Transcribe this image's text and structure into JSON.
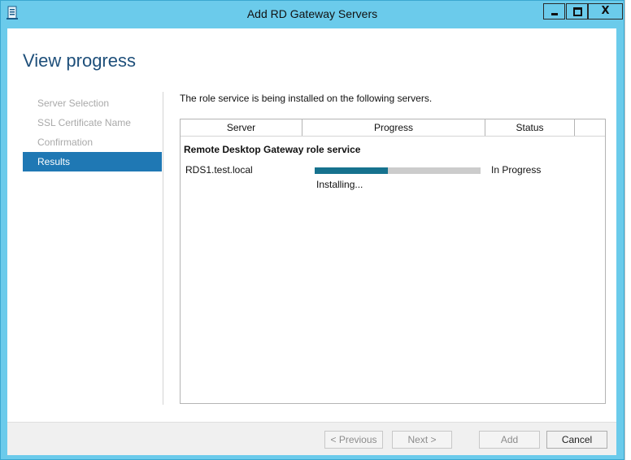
{
  "window": {
    "title": "Add RD Gateway Servers",
    "close_label": "X",
    "icons": [
      "server-manager-icon",
      "minimize-icon",
      "maximize-icon",
      "close-icon"
    ]
  },
  "page_title": "View progress",
  "nav": {
    "items": [
      {
        "label": "Server Selection",
        "state": "disabled"
      },
      {
        "label": "SSL Certificate Name",
        "state": "disabled"
      },
      {
        "label": "Confirmation",
        "state": "disabled"
      },
      {
        "label": "Results",
        "state": "active"
      }
    ]
  },
  "main": {
    "description": "The role service is being installed on the following servers.",
    "table": {
      "columns": [
        "Server",
        "Progress",
        "Status",
        ""
      ],
      "group": "Remote Desktop Gateway role service",
      "rows": [
        {
          "server": "RDS1.test.local",
          "progress_fraction": 0.44,
          "progress_text": "Installing...",
          "status": "In Progress"
        }
      ]
    }
  },
  "footer": {
    "previous": "< Previous",
    "next": "Next >",
    "add": "Add",
    "cancel": "Cancel"
  },
  "colors": {
    "titlebar": "#6bcbeb",
    "accent": "#1f78b4",
    "progress": "#16728e",
    "page_title": "#1e4f7a"
  }
}
